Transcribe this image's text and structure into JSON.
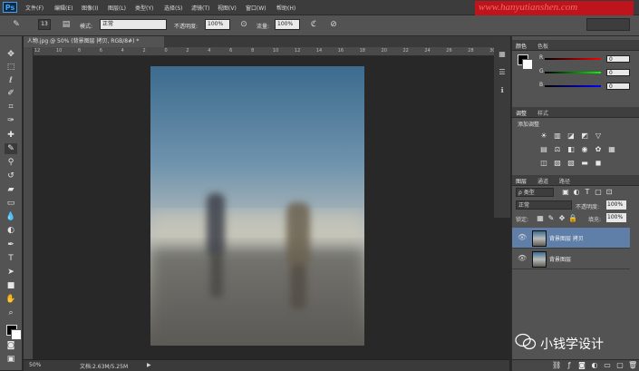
{
  "app": {
    "logo": "Ps",
    "watermark_text": "www.hanyutianshen.com"
  },
  "menu": [
    "文件(F)",
    "编辑(E)",
    "图像(I)",
    "图层(L)",
    "类型(Y)",
    "选择(S)",
    "滤镜(T)",
    "视图(V)",
    "窗口(W)",
    "帮助(H)"
  ],
  "options": {
    "brush_size": "13",
    "mode_label": "模式:",
    "mode_value": "正常",
    "opacity_label": "不透明度:",
    "opacity_value": "100%",
    "flow_label": "流量:",
    "flow_value": "100%"
  },
  "document": {
    "tab_title": "人物.jpg @ 50% (背景图层 拷贝, RGB/8#) *",
    "ruler_labels": [
      "12",
      "10",
      "8",
      "6",
      "4",
      "2",
      "0",
      "2",
      "4",
      "6",
      "8",
      "10",
      "12",
      "14",
      "16",
      "18",
      "20",
      "22",
      "24",
      "26",
      "28",
      "30"
    ],
    "zoom": "50%",
    "doc_size": "文档:2.63M/5.25M"
  },
  "color_panel": {
    "tabs": [
      "颜色",
      "色板"
    ],
    "r_label": "R",
    "g_label": "G",
    "b_label": "B",
    "r_value": "0",
    "g_value": "0",
    "b_value": "0"
  },
  "adjustments_panel": {
    "tabs": [
      "调整",
      "样式"
    ],
    "title": "添加调整"
  },
  "layers_panel": {
    "tabs": [
      "图层",
      "通道",
      "路径"
    ],
    "filter_label": "ρ 类型",
    "blend_mode": "正常",
    "opacity_label": "不透明度:",
    "opacity_value": "100%",
    "lock_label": "锁定:",
    "fill_label": "填充:",
    "fill_value": "100%",
    "layers": [
      {
        "name": "背景图层 拷贝",
        "selected": true
      },
      {
        "name": "背景图层",
        "selected": false
      }
    ]
  },
  "overlay": {
    "wechat_account": "小钱学设计"
  },
  "colors": {
    "accent": "#46a0f0",
    "watermark_bg": "#c0141c",
    "selected_layer": "#5f7fa8",
    "fg_color": "#000000",
    "bg_color": "#ffffff"
  },
  "icons": [
    "move-tool-icon",
    "marquee-tool-icon",
    "lasso-tool-icon",
    "quick-select-tool-icon",
    "crop-tool-icon",
    "eyedropper-tool-icon",
    "healing-brush-tool-icon",
    "brush-tool-icon",
    "clone-stamp-tool-icon",
    "history-brush-tool-icon",
    "eraser-tool-icon",
    "gradient-tool-icon",
    "blur-tool-icon",
    "dodge-tool-icon",
    "pen-tool-icon",
    "type-tool-icon",
    "path-select-tool-icon",
    "rectangle-tool-icon",
    "hand-tool-icon",
    "zoom-tool-icon"
  ]
}
